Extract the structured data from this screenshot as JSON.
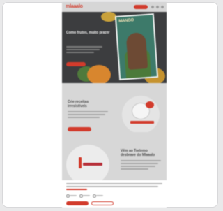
{
  "header": {
    "logo": "mlaaalo"
  },
  "hero": {
    "title": "Como frutos, muito prazer",
    "magazine_title": "MANGO"
  },
  "section_two": {
    "title": "Crie receitas irresistíveis"
  },
  "section_three": {
    "title": "Vêm ao Tortemo desbrave do Mlaaalo"
  },
  "colors": {
    "brand": "#d23b2c",
    "hero_bg": "#3c3d3f"
  }
}
